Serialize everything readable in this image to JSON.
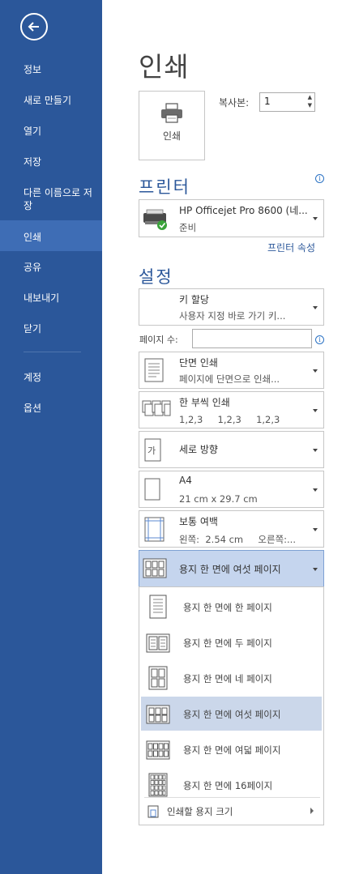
{
  "sidebar": {
    "items": [
      {
        "label": "정보"
      },
      {
        "label": "새로 만들기"
      },
      {
        "label": "열기"
      },
      {
        "label": "저장"
      },
      {
        "label": "다른 이름으로 저장"
      },
      {
        "label": "인쇄"
      },
      {
        "label": "공유"
      },
      {
        "label": "내보내기"
      },
      {
        "label": "닫기"
      },
      {
        "label": "계정"
      },
      {
        "label": "옵션"
      }
    ],
    "active": "인쇄"
  },
  "main": {
    "title": "인쇄",
    "print_button": "인쇄",
    "copies_label": "복사본:",
    "copies_value": "1",
    "printer": {
      "section_title": "프린터",
      "name": "HP Officejet Pro 8600 (네...",
      "status": "준비",
      "properties_link": "프린터 속성"
    },
    "settings": {
      "section_title": "설정",
      "pages_label": "페이지 수:",
      "pages_value": "",
      "dropdowns": [
        {
          "line1": "키 할당",
          "line2": "사용자 지정 바로 가기 키..."
        },
        {
          "line1": "단면 인쇄",
          "line2": "페이지에 단면으로 인쇄..."
        },
        {
          "line1": "한 부씩 인쇄",
          "line2": "1,2,3     1,2,3     1,2,3"
        },
        {
          "line1": "세로 방향",
          "line2": ""
        },
        {
          "line1": "A4",
          "line2": "21 cm x 29.7 cm"
        },
        {
          "line1": "보통 여백",
          "line2": "왼쪽:  2.54 cm     오른쪽:..."
        },
        {
          "line1": "용지 한 면에 여섯 페이지",
          "line2": ""
        }
      ]
    }
  },
  "flyout": {
    "items": [
      {
        "label": "용지 한 면에 한 페이지",
        "icon": "one-page-per-sheet-icon"
      },
      {
        "label": "용지 한 면에 두 페이지",
        "icon": "two-pages-per-sheet-icon"
      },
      {
        "label": "용지 한 면에 네 페이지",
        "icon": "four-pages-per-sheet-icon"
      },
      {
        "label": "용지 한 면에 여섯 페이지",
        "icon": "six-pages-per-sheet-icon"
      },
      {
        "label": "용지 한 면에 여덟 페이지",
        "icon": "eight-pages-per-sheet-icon"
      },
      {
        "label": "용지 한 면에 16페이지",
        "icon": "sixteen-pages-per-sheet-icon"
      }
    ],
    "selected": "용지 한 면에 여섯 페이지",
    "paper_size_item": "인쇄할 용지 크기"
  },
  "colors": {
    "sidebar_bg": "#2b579a",
    "sidebar_active": "#3e6db5",
    "accent": "#2b579a",
    "selected_bg": "#cbd7ea"
  }
}
